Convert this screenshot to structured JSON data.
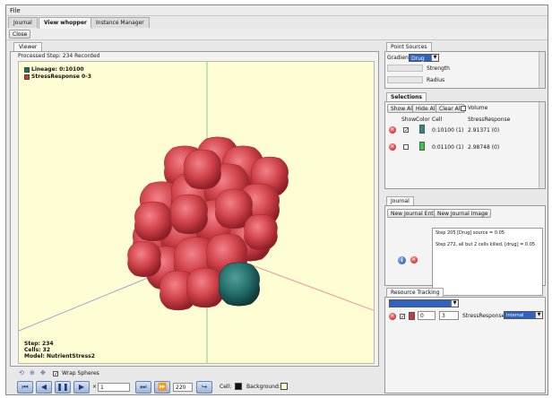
{
  "menu": {
    "file": "File"
  },
  "tabs": [
    {
      "label": "Journal"
    },
    {
      "label": "View whopper"
    },
    {
      "label": "Instance Manager"
    }
  ],
  "toolbar": {
    "close": "Close"
  },
  "viewer": {
    "tab": "Viewer",
    "processed": "Processed Step: 234 Recorded",
    "legend": [
      {
        "label": "Lineage: 0:10100",
        "color": "#1f6f6a"
      },
      {
        "label": "StressResponse 0-3",
        "color": "#c83a3a"
      }
    ],
    "stats": {
      "step": "Step: 234",
      "cells": "Cells: 32",
      "model": "Model: NutrientStress2"
    },
    "wrap_spheres": "Wrap Spheres",
    "speed_value": "1",
    "jump_value": "220",
    "cell_label": "Cell:",
    "background_label": "Background:"
  },
  "point_sources": {
    "tab": "Point Sources",
    "gradient_label": "Gradient:",
    "gradient_value": "Drug",
    "strength_label": "Strength",
    "radius_label": "Radius"
  },
  "selections": {
    "tab": "Selections",
    "show_all": "Show All",
    "hide_all": "Hide All",
    "clear_all": "Clear All",
    "volume": "Volume",
    "headers": {
      "show": "Show",
      "color": "Color",
      "cell": "Cell",
      "stress": "StressResponse"
    },
    "rows": [
      {
        "cell": "0:10100 (1)",
        "stress": "2.91371 (0)",
        "color": "#2a8a8a",
        "checked": "✓"
      },
      {
        "cell": "0:01100 (1)",
        "stress": "2.98748 (0)",
        "color": "#33cc44",
        "checked": ""
      }
    ]
  },
  "journal": {
    "tab": "Journal",
    "new_entry": "New Journal Entry",
    "new_image": "New Journal Image",
    "entries": [
      "Step 205 [Drug] source = 0.05",
      "Step 272, all but 2 cells killed, [drug] = 0.05"
    ]
  },
  "resource_tracking": {
    "tab": "Resource Tracking",
    "min_value": "0",
    "max_value": "3",
    "variable": "StressResponse",
    "mode": "Internal"
  }
}
